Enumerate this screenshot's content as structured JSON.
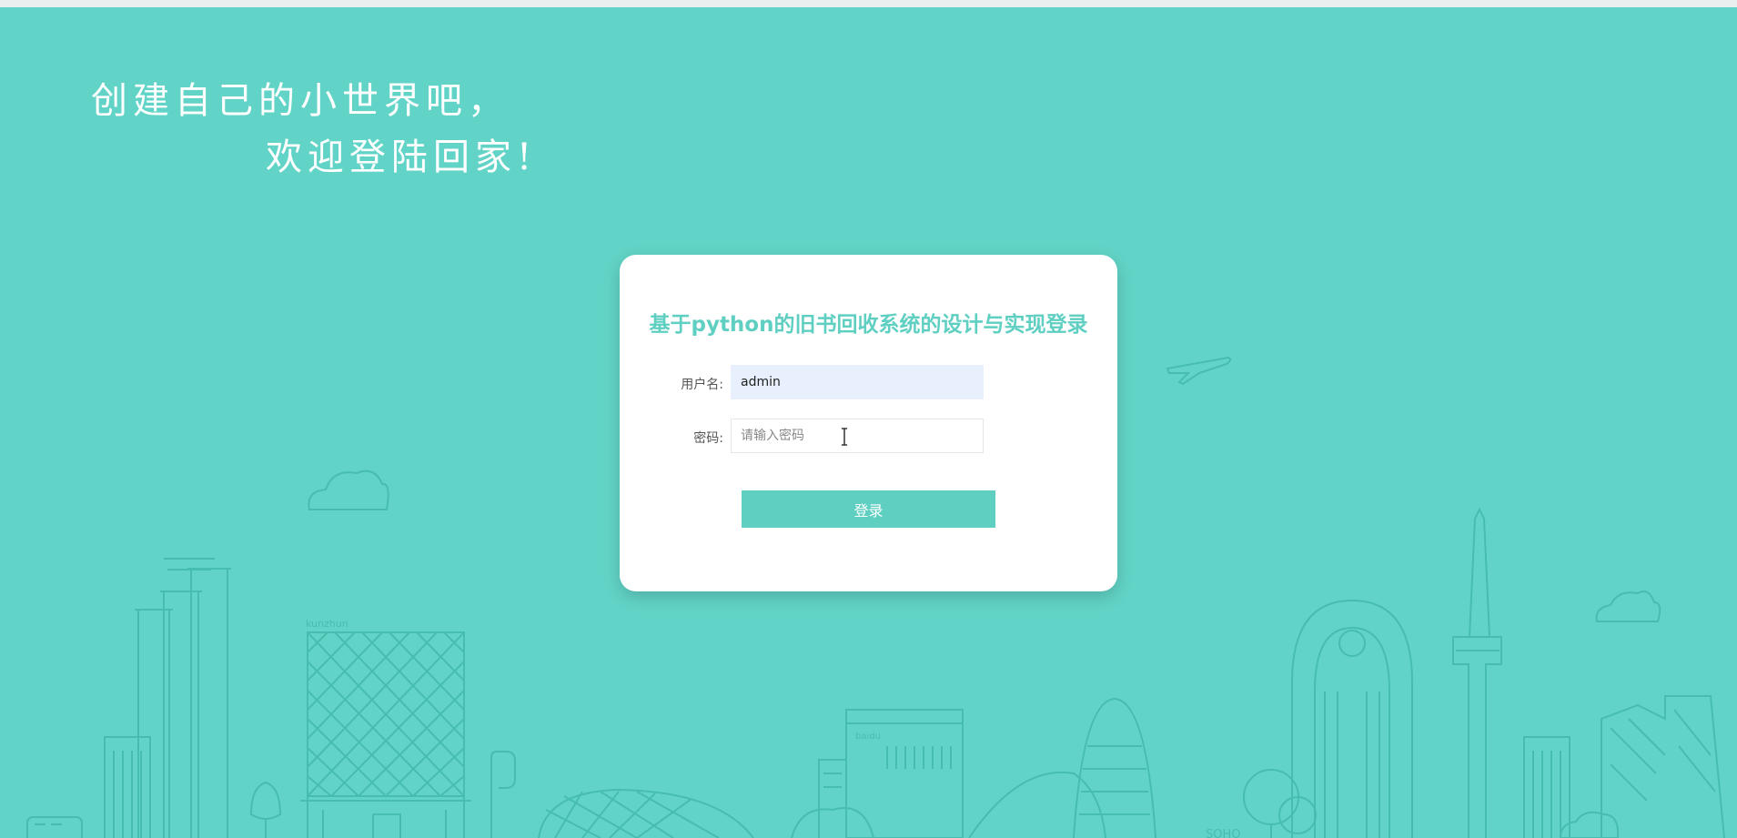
{
  "slogan": {
    "line1": "创建自己的小世界吧，",
    "line2": "欢迎登陆回家!"
  },
  "login": {
    "title": "基于python的旧书回收系统的设计与实现登录",
    "username_label": "用户名:",
    "username_value": "admin",
    "password_label": "密码:",
    "password_placeholder": "请输入密码",
    "submit_label": "登录"
  },
  "background": {
    "building_labels": [
      "kunzhun",
      "baidu",
      "SOHO"
    ]
  },
  "colors": {
    "background": "#62d4c7",
    "accent": "#5fcfc2",
    "line_art": "#46bdb0",
    "card": "#ffffff",
    "autofill": "#e8f0fe"
  },
  "icons": [
    "cloud-icon",
    "airplane-icon",
    "bus-icon",
    "tree-icon",
    "text-cursor-icon"
  ]
}
